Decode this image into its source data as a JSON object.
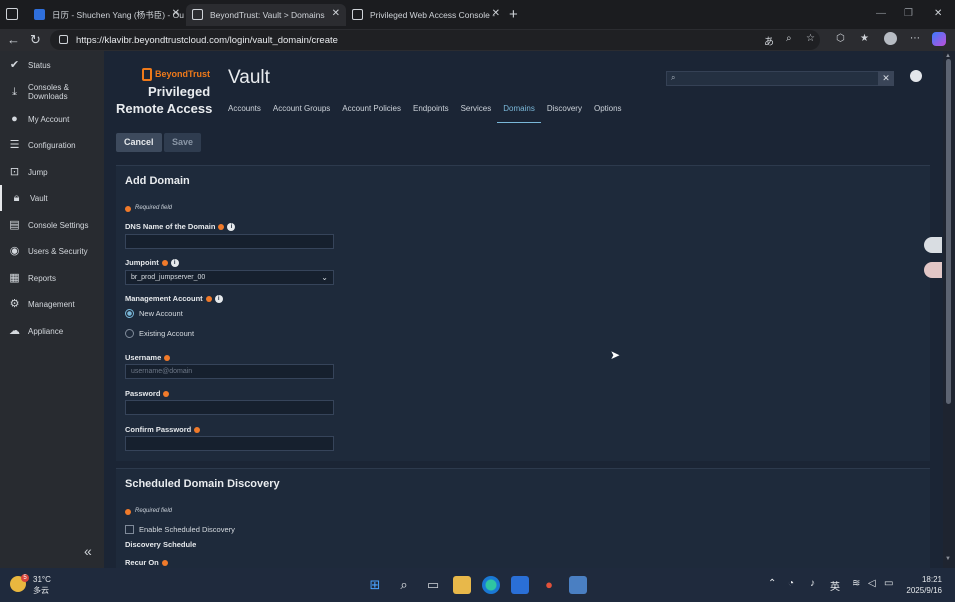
{
  "browser": {
    "tabs": [
      {
        "label": "日历 - Shuchen Yang (杨书臣) - Ou"
      },
      {
        "label": "BeyondTrust: Vault > Domains"
      },
      {
        "label": "Privileged Web Access Console -"
      }
    ],
    "url": "https://klavibr.beyondtrustcloud.com/login/vault_domain/create"
  },
  "sidebar": {
    "items": [
      {
        "label": "Status",
        "icon": "check-circle-icon"
      },
      {
        "label": "Consoles & Downloads",
        "icon": "download-icon"
      },
      {
        "label": "My Account",
        "icon": "user-icon"
      },
      {
        "label": "Configuration",
        "icon": "sliders-icon"
      },
      {
        "label": "Jump",
        "icon": "jump-icon"
      },
      {
        "label": "Vault",
        "icon": "lock-icon"
      },
      {
        "label": "Console Settings",
        "icon": "chat-icon"
      },
      {
        "label": "Users & Security",
        "icon": "users-icon"
      },
      {
        "label": "Reports",
        "icon": "report-icon"
      },
      {
        "label": "Management",
        "icon": "gear-icon"
      },
      {
        "label": "Appliance",
        "icon": "cloud-icon"
      }
    ]
  },
  "header": {
    "logo_text": "BeyondTrust",
    "product_line1": "Privileged",
    "product_line2": "Remote Access",
    "title": "Vault",
    "subnav": [
      "Accounts",
      "Account Groups",
      "Account Policies",
      "Endpoints",
      "Services",
      "Domains",
      "Discovery",
      "Options"
    ],
    "active_subnav": "Domains"
  },
  "actions": {
    "cancel": "Cancel",
    "save": "Save"
  },
  "add_domain": {
    "title": "Add Domain",
    "required_note": "Required field",
    "dns_label": "DNS Name of the Domain",
    "dns_value": "",
    "jumpoint_label": "Jumpoint",
    "jumpoint_value": "br_prod_jumpserver_00",
    "mgmt_label": "Management Account",
    "radio_new": "New Account",
    "radio_existing": "Existing Account",
    "username_label": "Username",
    "username_placeholder": "username@domain",
    "password_label": "Password",
    "confirm_label": "Confirm Password"
  },
  "discovery": {
    "title": "Scheduled Domain Discovery",
    "required_note": "Required field",
    "enable_label": "Enable Scheduled Discovery",
    "schedule_label": "Discovery Schedule",
    "recur_label": "Recur On"
  },
  "taskbar": {
    "weather_temp": "31°C",
    "weather_desc": "多云",
    "weather_badge": "5",
    "ime": "英",
    "time": "18:21",
    "date": "2025/9/16"
  }
}
